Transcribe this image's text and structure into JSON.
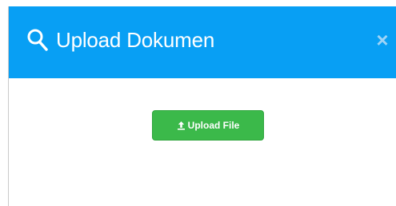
{
  "modal": {
    "title": "Upload Dokumen",
    "title_icon": "search-icon",
    "close_icon": "close-icon",
    "close_label": "×"
  },
  "upload": {
    "button_label": "Upload File",
    "icon": "upload-icon"
  },
  "colors": {
    "header": "#089ff4",
    "button": "#3bb94a"
  }
}
